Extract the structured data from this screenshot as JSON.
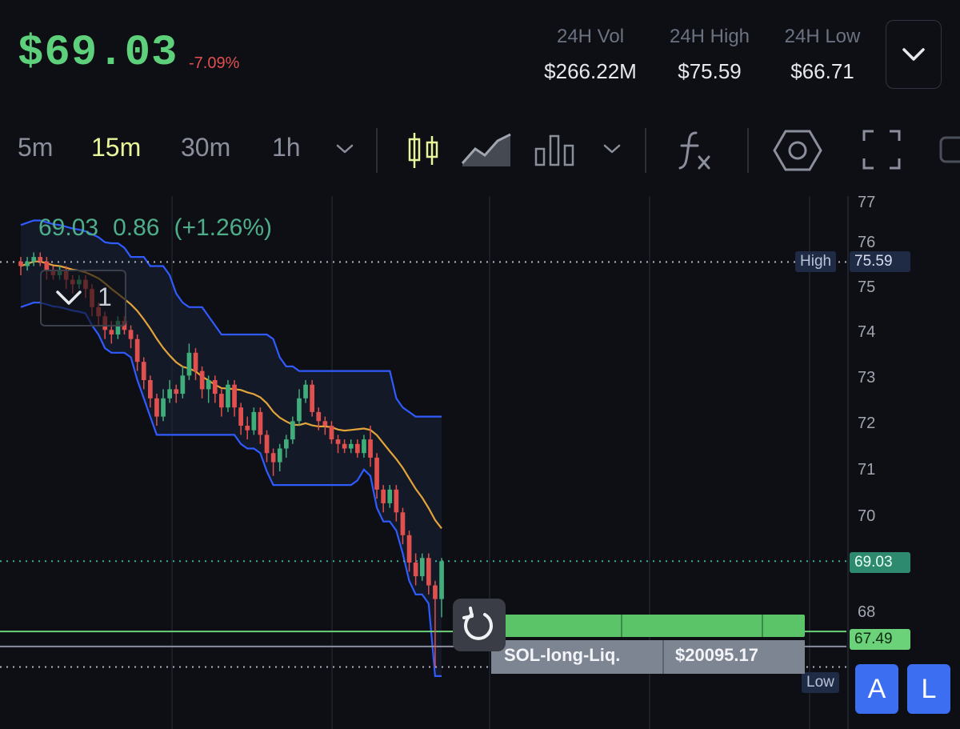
{
  "header": {
    "price": "$69.03",
    "change": "-7.09%",
    "stats": [
      {
        "label": "24H Vol",
        "value": "$266.22M"
      },
      {
        "label": "24H High",
        "value": "$75.59"
      },
      {
        "label": "24H Low",
        "value": "$66.71"
      }
    ],
    "dropdown_icon": "chevron-down-icon"
  },
  "toolbar": {
    "intervals": [
      "5m",
      "15m",
      "30m",
      "1h"
    ],
    "active_interval": "15m",
    "icons": [
      "chevron-down-icon",
      "candlestick-icon",
      "area-chart-icon",
      "bar-chart-icon",
      "chevron-down-icon",
      "fx-icon",
      "settings-hexagon-icon",
      "fullscreen-icon"
    ]
  },
  "chart": {
    "legend": {
      "price": "69.03",
      "change": "0.86",
      "percent": "(+1.26%)"
    },
    "indicator_count": "1",
    "y_ticks": [
      "77",
      "76",
      "75",
      "74",
      "73",
      "72",
      "71",
      "70",
      "68"
    ],
    "high_label": "High",
    "high_value": "75.59",
    "current_value": "69.03",
    "liq_value": "67.49",
    "low_label": "Low",
    "colors": {
      "up": "#3fae7a",
      "down": "#e0504e",
      "band": "#2f5bff",
      "mid": "#e3a43a",
      "accent": "#5ed07c"
    }
  },
  "liquidation": {
    "name": "SOL-long-Liq.",
    "amount": "$20095.17"
  },
  "bottom_buttons": {
    "a": "A",
    "l": "L"
  },
  "chart_data": {
    "type": "candlestick",
    "y_range": [
      66.5,
      77
    ],
    "high_line": 75.59,
    "current_line": 69.03,
    "liq_line": 67.49,
    "low_line": 66.71,
    "candles": [
      [
        75.6,
        75.5,
        75.7,
        75.3
      ],
      [
        75.5,
        75.6,
        75.7,
        75.4
      ],
      [
        75.6,
        75.7,
        75.8,
        75.5
      ],
      [
        75.7,
        75.6,
        75.8,
        75.5
      ],
      [
        75.6,
        75.4,
        75.7,
        75.2
      ],
      [
        75.4,
        75.3,
        75.5,
        75.2
      ],
      [
        75.3,
        75.4,
        75.5,
        75.2
      ],
      [
        75.4,
        75.2,
        75.5,
        75.0
      ],
      [
        75.2,
        75.1,
        75.3,
        74.9
      ],
      [
        75.1,
        75.2,
        75.3,
        75.0
      ],
      [
        75.2,
        75.0,
        75.3,
        74.8
      ],
      [
        75.0,
        74.6,
        75.1,
        74.4
      ],
      [
        74.6,
        74.4,
        74.7,
        74.2
      ],
      [
        74.4,
        74.1,
        74.5,
        73.9
      ],
      [
        74.1,
        74.0,
        74.3,
        73.8
      ],
      [
        74.0,
        74.3,
        74.4,
        73.9
      ],
      [
        74.3,
        74.1,
        74.4,
        74.0
      ],
      [
        74.1,
        73.9,
        74.2,
        73.7
      ],
      [
        73.9,
        73.4,
        74.0,
        73.2
      ],
      [
        73.4,
        73.0,
        73.5,
        72.8
      ],
      [
        73.0,
        72.6,
        73.1,
        72.4
      ],
      [
        72.6,
        72.2,
        72.7,
        72.0
      ],
      [
        72.2,
        72.6,
        72.8,
        72.1
      ],
      [
        72.6,
        72.8,
        73.0,
        72.5
      ],
      [
        72.8,
        72.7,
        72.9,
        72.5
      ],
      [
        72.7,
        73.1,
        73.3,
        72.6
      ],
      [
        73.1,
        73.6,
        73.8,
        73.0
      ],
      [
        73.6,
        73.2,
        73.7,
        73.0
      ],
      [
        73.2,
        72.8,
        73.3,
        72.6
      ],
      [
        72.8,
        73.0,
        73.1,
        72.5
      ],
      [
        73.0,
        72.7,
        73.1,
        72.5
      ],
      [
        72.7,
        72.4,
        72.8,
        72.2
      ],
      [
        72.4,
        72.9,
        73.0,
        72.3
      ],
      [
        72.9,
        72.4,
        73.0,
        72.2
      ],
      [
        72.4,
        72.0,
        72.5,
        71.8
      ],
      [
        72.0,
        71.9,
        72.2,
        71.7
      ],
      [
        71.9,
        72.3,
        72.4,
        71.8
      ],
      [
        72.3,
        71.8,
        72.4,
        71.6
      ],
      [
        71.8,
        71.4,
        71.9,
        71.2
      ],
      [
        71.4,
        71.2,
        71.5,
        70.9
      ],
      [
        71.2,
        71.5,
        71.6,
        71.0
      ],
      [
        71.5,
        71.7,
        71.8,
        71.3
      ],
      [
        71.7,
        72.1,
        72.2,
        71.6
      ],
      [
        72.1,
        72.6,
        72.8,
        72.0
      ],
      [
        72.6,
        72.9,
        73.0,
        72.5
      ],
      [
        72.9,
        72.3,
        73.0,
        72.2
      ],
      [
        72.3,
        72.1,
        72.4,
        71.9
      ],
      [
        72.1,
        72.0,
        72.2,
        71.8
      ],
      [
        72.0,
        71.7,
        72.1,
        71.6
      ],
      [
        71.7,
        71.6,
        71.8,
        71.4
      ],
      [
        71.6,
        71.5,
        71.7,
        71.4
      ],
      [
        71.5,
        71.6,
        71.7,
        71.4
      ],
      [
        71.6,
        71.4,
        71.7,
        71.3
      ],
      [
        71.4,
        71.7,
        71.8,
        71.3
      ],
      [
        71.7,
        71.3,
        72.0,
        71.1
      ],
      [
        71.3,
        70.6,
        71.4,
        70.4
      ],
      [
        70.6,
        70.3,
        70.7,
        70.1
      ],
      [
        70.3,
        70.6,
        70.7,
        70.2
      ],
      [
        70.6,
        70.1,
        70.7,
        69.9
      ],
      [
        70.1,
        69.6,
        70.2,
        69.4
      ],
      [
        69.6,
        69.0,
        69.7,
        68.8
      ],
      [
        69.0,
        68.7,
        69.2,
        68.5
      ],
      [
        68.7,
        69.1,
        69.2,
        68.6
      ],
      [
        69.1,
        68.5,
        69.2,
        68.3
      ],
      [
        68.5,
        68.2,
        68.6,
        66.71
      ],
      [
        68.2,
        69.03,
        69.1,
        67.8
      ]
    ]
  }
}
